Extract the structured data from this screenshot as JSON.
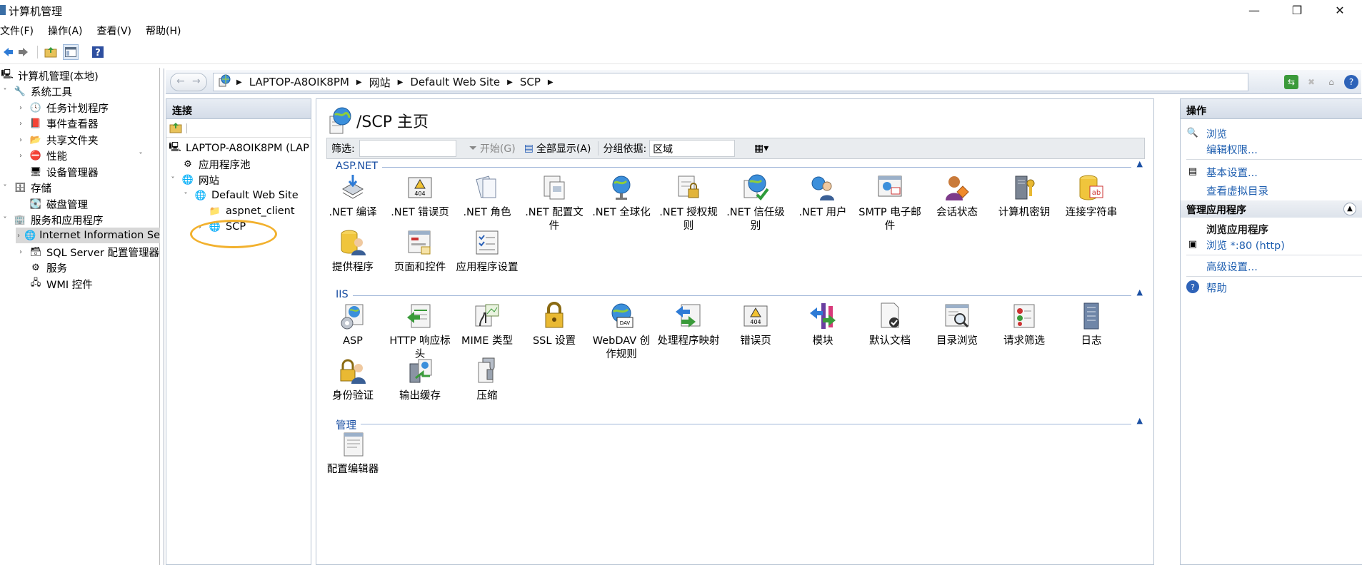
{
  "window": {
    "title": "计算机管理",
    "controls": [
      "—",
      "❐",
      "✕"
    ]
  },
  "menu": [
    "文件(F)",
    "操作(A)",
    "查看(V)",
    "帮助(H)"
  ],
  "mmc_tree": {
    "root": "计算机管理(本地)",
    "system_tools": "系统工具",
    "task_scheduler": "任务计划程序",
    "event_viewer": "事件查看器",
    "shared_folders": "共享文件夹",
    "performance": "性能",
    "device_manager": "设备管理器",
    "storage": "存储",
    "disk_management": "磁盘管理",
    "services_apps": "服务和应用程序",
    "iis": "Internet Information Se",
    "sql_config": "SQL Server 配置管理器",
    "services": "服务",
    "wmi": "WMI 控件"
  },
  "address": {
    "crumbs": [
      "LAPTOP-A8OIK8PM",
      "网站",
      "Default Web Site",
      "SCP"
    ]
  },
  "connections": {
    "header": "连接",
    "server": "LAPTOP-A8OIK8PM (LAP",
    "app_pools": "应用程序池",
    "sites": "网站",
    "default_site": "Default Web Site",
    "aspnet_client": "aspnet_client",
    "scp": "SCP"
  },
  "main": {
    "title": "/SCP 主页",
    "filter": {
      "label": "筛选:",
      "start": "开始(G)",
      "show_all": "全部显示(A)",
      "group_label": "分组依据:",
      "group_value": "区域"
    },
    "sections": {
      "aspnet": "ASP.NET",
      "iis": "IIS",
      "manage": "管理"
    },
    "aspnet_features": [
      ".NET 编译",
      ".NET 错误页",
      ".NET 角色",
      ".NET 配置文件",
      ".NET 全球化",
      ".NET 授权规则",
      ".NET 信任级别",
      ".NET 用户",
      "SMTP 电子邮件",
      "会话状态",
      "计算机密钥",
      "连接字符串",
      "提供程序",
      "页面和控件",
      "应用程序设置"
    ],
    "iis_features": [
      "ASP",
      "HTTP 响应标头",
      "MIME 类型",
      "SSL 设置",
      "WebDAV 创作规则",
      "处理程序映射",
      "错误页",
      "模块",
      "默认文档",
      "目录浏览",
      "请求筛选",
      "日志",
      "身份验证",
      "输出缓存",
      "压缩"
    ],
    "manage_features": [
      "配置编辑器"
    ]
  },
  "actions": {
    "header": "操作",
    "browse": "浏览",
    "edit_permissions": "编辑权限...",
    "basic_settings": "基本设置...",
    "view_vdirs": "查看虚拟目录",
    "manage_app_header": "管理应用程序",
    "browse_app": "浏览应用程序",
    "browse_port": "浏览 *:80 (http)",
    "advanced_settings": "高级设置...",
    "help": "帮助"
  }
}
